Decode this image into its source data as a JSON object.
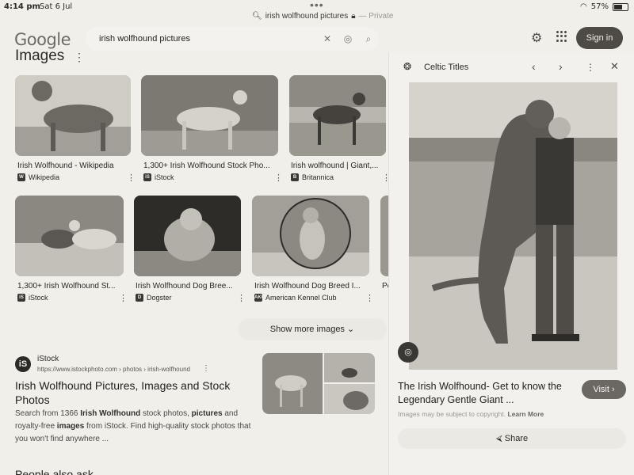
{
  "status": {
    "time": "4:14 pm",
    "date": "Sat 6 Jul",
    "url": "irish wolfhound pictures",
    "private": "— Private",
    "battery": "57%"
  },
  "header": {
    "logo": "Google",
    "query": "irish wolfhound pictures",
    "signin": "Sign in"
  },
  "images": {
    "title": "Images",
    "show_more": "Show more images",
    "row1": [
      {
        "caption": "Irish Wolfhound - Wikipedia",
        "source": "Wikipedia",
        "fav": "W"
      },
      {
        "caption": "1,300+ Irish Wolfhound Stock Pho...",
        "source": "iStock",
        "fav": "iS"
      },
      {
        "caption": "Irish wolfhound | Giant,...",
        "source": "Britannica",
        "fav": "B"
      }
    ],
    "row2": [
      {
        "caption": "1,300+ Irish Wolfhound St...",
        "source": "iStock",
        "fav": "iS"
      },
      {
        "caption": "Irish Wolfhound Dog Bree...",
        "source": "Dogster",
        "fav": "D"
      },
      {
        "caption": "Irish Wolfhound Dog Breed I...",
        "source": "American Kennel Club",
        "fav": "AKC"
      },
      {
        "caption": "Pe",
        "source": "",
        "fav": ""
      }
    ]
  },
  "result": {
    "site": "iStock",
    "url": "https://www.istockphoto.com › photos › irish-wolfhound",
    "title": "Irish Wolfhound Pictures, Images and Stock Photos",
    "snippet_a": "Search from 1366 ",
    "snippet_b": "Irish Wolfhound",
    "snippet_c": " stock photos, ",
    "snippet_d": "pictures",
    "snippet_e": " and royalty-free ",
    "snippet_f": "images",
    "snippet_g": " from iStock. Find high-quality stock photos that you won't find anywhere ...",
    "bottom_heading": "People also ask"
  },
  "panel": {
    "source": "Celtic Titles",
    "title": "The Irish Wolfhound- Get to know the Legendary Gentle Giant ...",
    "visit": "Visit",
    "copyright": "Images may be subject to copyright.",
    "learn_more": "Learn More",
    "share": "Share"
  }
}
